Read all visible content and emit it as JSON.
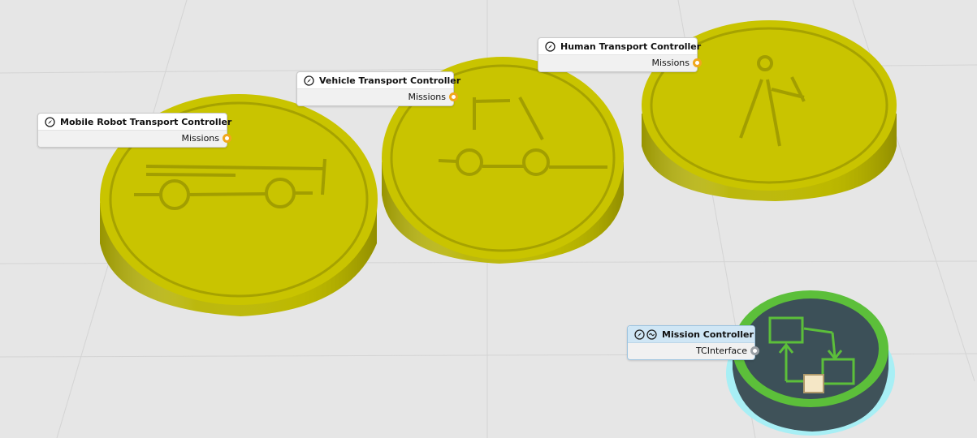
{
  "scene": {
    "background": "#e6e6e6",
    "grid_color": "#d2d2d2",
    "puck_color": "#c8c400",
    "puck_dark": "#8f8b00",
    "mission_puck_color": "#3c5058",
    "mission_ring_color": "#5cbf3a",
    "mission_glow_color": "#9de7ef"
  },
  "labels": [
    {
      "id": "mobile",
      "title": "Mobile Robot Transport Controller",
      "port": "Missions",
      "icon": "compass-icon",
      "port_color": "#f0a81c"
    },
    {
      "id": "vehicle",
      "title": "Vehicle Transport Controller",
      "port": "Missions",
      "icon": "compass-icon",
      "port_color": "#f0a81c"
    },
    {
      "id": "human",
      "title": "Human Transport Controller",
      "port": "Missions",
      "icon": "compass-icon",
      "port_color": "#f0a81c"
    },
    {
      "id": "mission",
      "title": "Mission Controller",
      "port": "TCInterface",
      "icon": "compass-icon",
      "icon2": "sync-icon",
      "port_color": "#9aa0a6"
    }
  ]
}
